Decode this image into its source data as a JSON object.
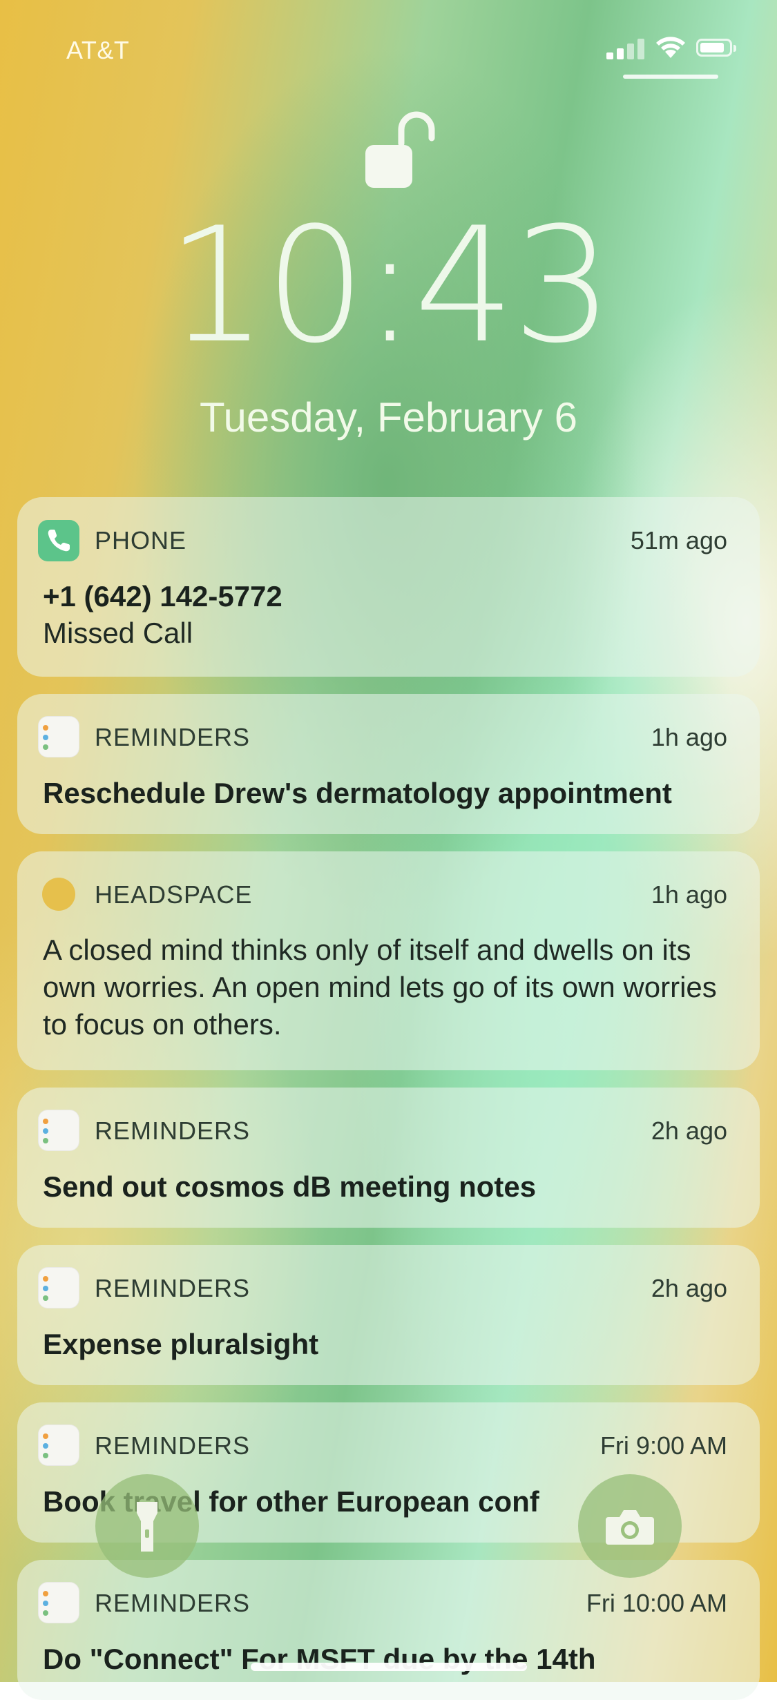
{
  "status_bar": {
    "carrier": "AT&T"
  },
  "lock_screen": {
    "time": "10:43",
    "date": "Tuesday, February 6"
  },
  "notifications": [
    {
      "app": "PHONE",
      "time": "51m ago",
      "title": "+1 (642) 142-5772",
      "body": "Missed Call",
      "icon": "phone-icon"
    },
    {
      "app": "REMINDERS",
      "time": "1h ago",
      "title": "Reschedule Drew's dermatology appointment",
      "icon": "reminders-icon"
    },
    {
      "app": "HEADSPACE",
      "time": "1h ago",
      "body": "A closed mind thinks only of itself and dwells on its own worries. An open mind lets go of its own worries to focus on others.",
      "icon": "headspace-icon"
    },
    {
      "app": "REMINDERS",
      "time": "2h ago",
      "title": "Send out cosmos dB meeting notes",
      "icon": "reminders-icon"
    },
    {
      "app": "REMINDERS",
      "time": "2h ago",
      "title": "Expense pluralsight",
      "icon": "reminders-icon"
    },
    {
      "app": "REMINDERS",
      "time": "Fri 9:00 AM",
      "title": "Book travel for other European conf",
      "icon": "reminders-icon"
    },
    {
      "app": "REMINDERS",
      "time": "Fri 10:00 AM",
      "title": "Do \"Connect\" For MSFT due by the 14th",
      "icon": "reminders-icon"
    }
  ],
  "quick_actions": {
    "flashlight": "flashlight-icon",
    "camera": "camera-icon"
  },
  "colors": {
    "phone_green": "#5cc48a",
    "headspace_yellow": "#e6c04c"
  }
}
